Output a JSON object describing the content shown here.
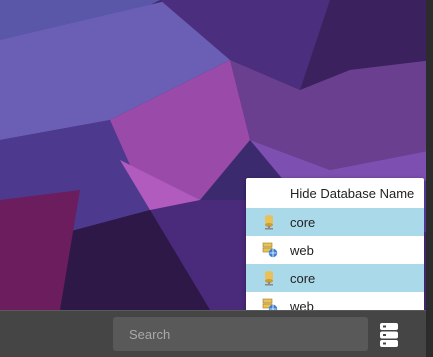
{
  "desktop": {
    "wallpaper": "purple-abstract"
  },
  "menu": {
    "items": [
      {
        "label": "Hide Database Name",
        "icon": "none",
        "selected": false
      },
      {
        "label": "core",
        "icon": "db-core-icon",
        "selected": true
      },
      {
        "label": "web",
        "icon": "db-web-icon",
        "selected": false
      },
      {
        "label": "core",
        "icon": "db-core-icon",
        "selected": true
      },
      {
        "label": "web",
        "icon": "db-web-icon",
        "selected": false
      }
    ],
    "selected_color": "#aad9ea"
  },
  "taskbar": {
    "search_placeholder": "Search",
    "database_button_icon": "database-icon"
  }
}
